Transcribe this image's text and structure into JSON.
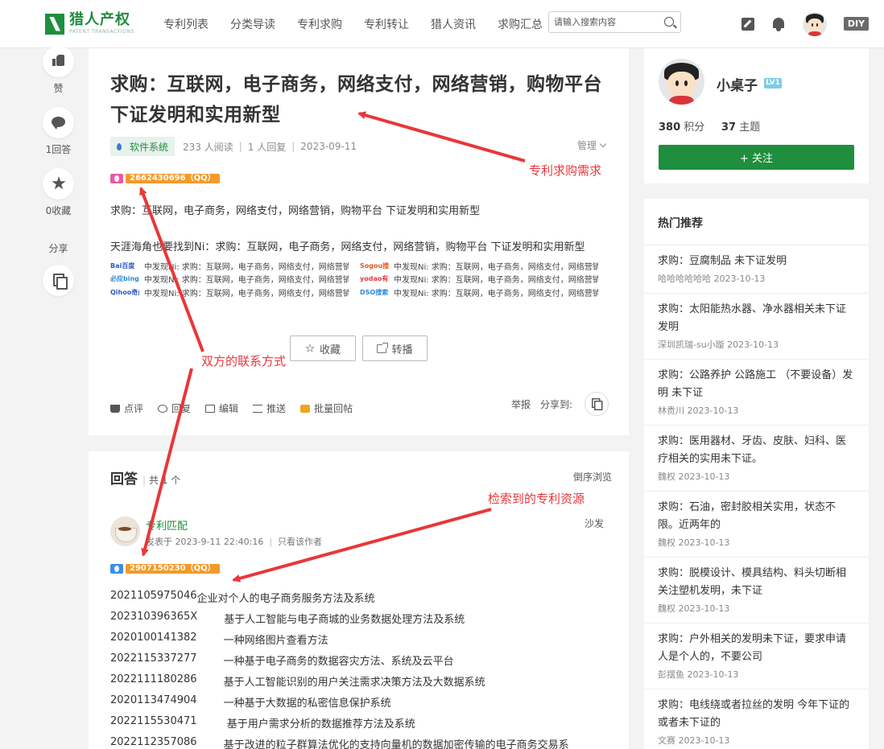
{
  "header": {
    "logo_cn": "猎人产权",
    "logo_en": "PATENT TRANSACTIONS",
    "nav": [
      "专利列表",
      "分类导读",
      "专利求购",
      "专利转让",
      "猎人资讯",
      "求购汇总"
    ],
    "search_placeholder": "请输入搜索内容",
    "diy": "DIY"
  },
  "left_toolbar": {
    "like": "赞",
    "answers": "1回答",
    "favorites": "0收藏",
    "share": "分享"
  },
  "post": {
    "title": "求购：互联网，电子商务，网络支付，网络营销，购物平台 下证发明和实用新型",
    "tag": "软件系统",
    "reads": "233 人阅读",
    "replies": "1 人回复",
    "date": "2023-09-11",
    "manage": "管理",
    "qq": "2662430696（QQ）",
    "body1": "求购：互联网，电子商务，网络支付，网络营销，购物平台  下证发明和实用新型",
    "body2": "天涯海角也要找到Ni：求购：互联网，电子商务，网络支付，网络营销，购物平台 下证发明和实用新型",
    "sources": [
      {
        "logo": "Bai百度",
        "color": "#2b58c8",
        "text": "中发现Ni:   求购：互联网，电子商务，网络支付，网络营销，购物平台"
      },
      {
        "logo": "Sogou搜狗",
        "color": "#e8541f",
        "text": "中发现Ni:   求购：互联网，电子商务，网络支付，网络营销，购物平台"
      },
      {
        "logo": "必应bing",
        "color": "#2b8ad8",
        "text": "中发现Ni:   求购：互联网，电子商务，网络支付，网络营销，购物平台"
      },
      {
        "logo": "yodao有道",
        "color": "#e8373a",
        "text": "中发现Ni:   求购：互联网，电子商务，网络支付，网络营销，购物平台"
      },
      {
        "logo": "Qihoo奇虎",
        "color": "#2b58c8",
        "text": "中发现Ni:   求购：互联网，电子商务，网络支付，网络营销，购物平台"
      },
      {
        "logo": "DSO搜索",
        "color": "#2b8ad8",
        "text": "中发现Ni:   求购：互联网，电子商务，网络支付，网络营销，购物平台"
      }
    ],
    "btn_fav": "收藏",
    "btn_share": "转播",
    "actions": [
      "点评",
      "回复",
      "编辑",
      "推送",
      "批量回帖"
    ],
    "report": "举报",
    "share_to": "分享到:"
  },
  "answers": {
    "title": "回答",
    "count": "共 1 个",
    "reverse": "倒序浏览",
    "user": "专利匹配",
    "time": "发表于 2023-9-11 22:40:16",
    "only_author": "只看该作者",
    "sofa": "沙发",
    "qq": "2907150230（QQ）",
    "patents": [
      {
        "no": "2021105975046",
        "gap": "",
        "name": "企业对个人的电子商务服务方法及系统"
      },
      {
        "no": "202310396365X",
        "gap": "        ",
        "name": "基于人工智能与电子商城的业务数据处理方法及系统"
      },
      {
        "no": "2020100141382",
        "gap": "        ",
        "name": "一种网络图片查看方法"
      },
      {
        "no": "2022115337277",
        "gap": "        ",
        "name": "一种基于电子商务的数据容灾方法、系统及云平台"
      },
      {
        "no": "2022111180286",
        "gap": "        ",
        "name": "基于人工智能识别的用户关注需求决策方法及大数据系统"
      },
      {
        "no": "2020113474904",
        "gap": "        ",
        "name": "一种基于大数据的私密信息保护系统"
      },
      {
        "no": "2022115530471",
        "gap": "         ",
        "name": "基于用户需求分析的数据推荐方法及系统"
      },
      {
        "no": "2022112357086",
        "gap": "        ",
        "name": "基于改进的粒子群算法优化的支持向量机的数据加密传输的电子商务交易系"
      }
    ]
  },
  "user_card": {
    "name": "小桌子",
    "level": "LV1",
    "points": "380",
    "points_label": "积分",
    "topics": "37",
    "topics_label": "主题",
    "follow": "+ 关注"
  },
  "hot": {
    "title": "热门推荐",
    "items": [
      {
        "text": "求购：豆腐制品 未下证发明",
        "meta": "哈哈哈哈哈哈 2023-10-13"
      },
      {
        "text": "求购：太阳能热水器、净水器相关未下证发明",
        "meta": "深圳凯瑞-su小璇 2023-10-13"
      },
      {
        "text": "求购：公路养护 公路施工 （不要设备）发明 未下证",
        "meta": "林贵川 2023-10-13"
      },
      {
        "text": "求购：医用器材、牙齿、皮肤、妇科、医疗相关的实用未下证。",
        "meta": "魏权 2023-10-13"
      },
      {
        "text": "求购：石油，密封胶相关实用，状态不限。近两年的",
        "meta": "魏权 2023-10-13"
      },
      {
        "text": "求购：脱模设计、模具结构、料头切断相关注塑机发明，未下证",
        "meta": "魏权 2023-10-13"
      },
      {
        "text": "求购：户外相关的发明未下证，要求申请人是个人的，不要公司",
        "meta": "彭摆鱼 2023-10-13"
      },
      {
        "text": "求购：电线绕或者拉丝的发明 今年下证的或者未下证的",
        "meta": "文赛 2023-10-13"
      }
    ]
  },
  "annotations": {
    "demand": "专利求购需求",
    "contact": "双方的联系方式",
    "resources": "检索到的专利资源"
  },
  "colors": {
    "brand": "#1f8e3d",
    "annotation": "#e8373a",
    "qq_badge": "#f39a2b"
  }
}
